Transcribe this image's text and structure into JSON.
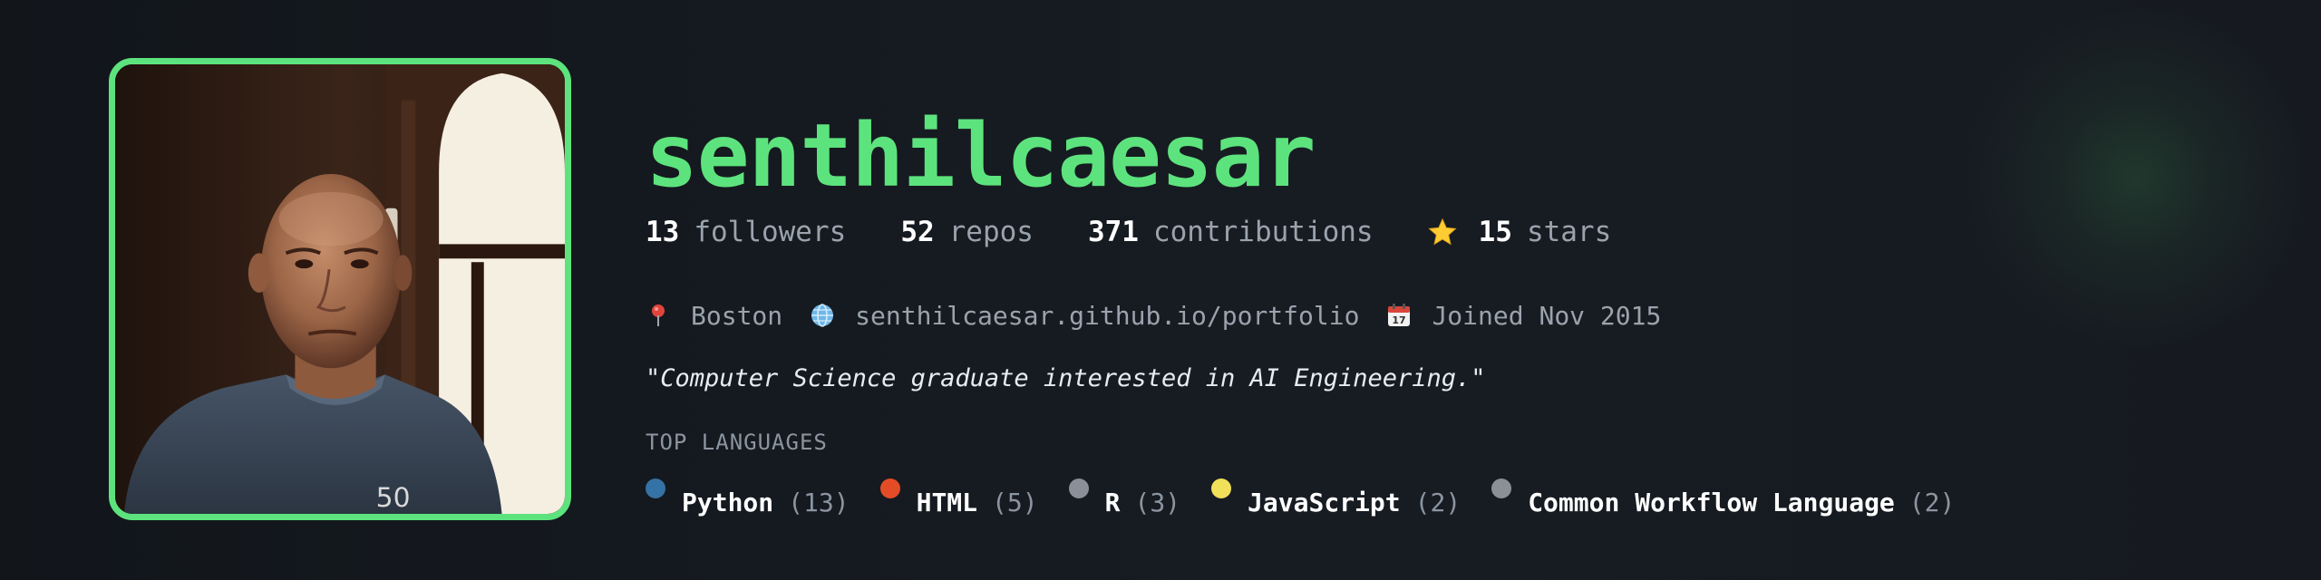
{
  "profile": {
    "username": "senthilcaesar",
    "avatar_alt": "avatar photo",
    "accent_color": "#5de37d"
  },
  "stats": [
    {
      "value": "13",
      "label": "followers"
    },
    {
      "value": "52",
      "label": "repos"
    },
    {
      "value": "371",
      "label": "contributions"
    },
    {
      "value": "15",
      "label": "stars",
      "icon": "star-icon"
    }
  ],
  "meta": {
    "location": "Boston",
    "location_icon": "pin-icon",
    "website": "senthilcaesar.github.io/portfolio",
    "website_icon": "globe-icon",
    "joined": "Joined Nov 2015",
    "joined_icon": "calendar-icon"
  },
  "bio": "\"Computer Science graduate interested in AI Engineering.\"",
  "languages": {
    "title": "TOP LANGUAGES",
    "items": [
      {
        "name": "Python",
        "count": "(13)",
        "color": "#3572A5"
      },
      {
        "name": "HTML",
        "count": "(5)",
        "color": "#e34c26"
      },
      {
        "name": "R",
        "count": "(3)",
        "color": "#8b8f98"
      },
      {
        "name": "JavaScript",
        "count": "(2)",
        "color": "#f1e05a"
      },
      {
        "name": "Common Workflow Language",
        "count": "(2)",
        "color": "#8b8f98"
      }
    ]
  }
}
